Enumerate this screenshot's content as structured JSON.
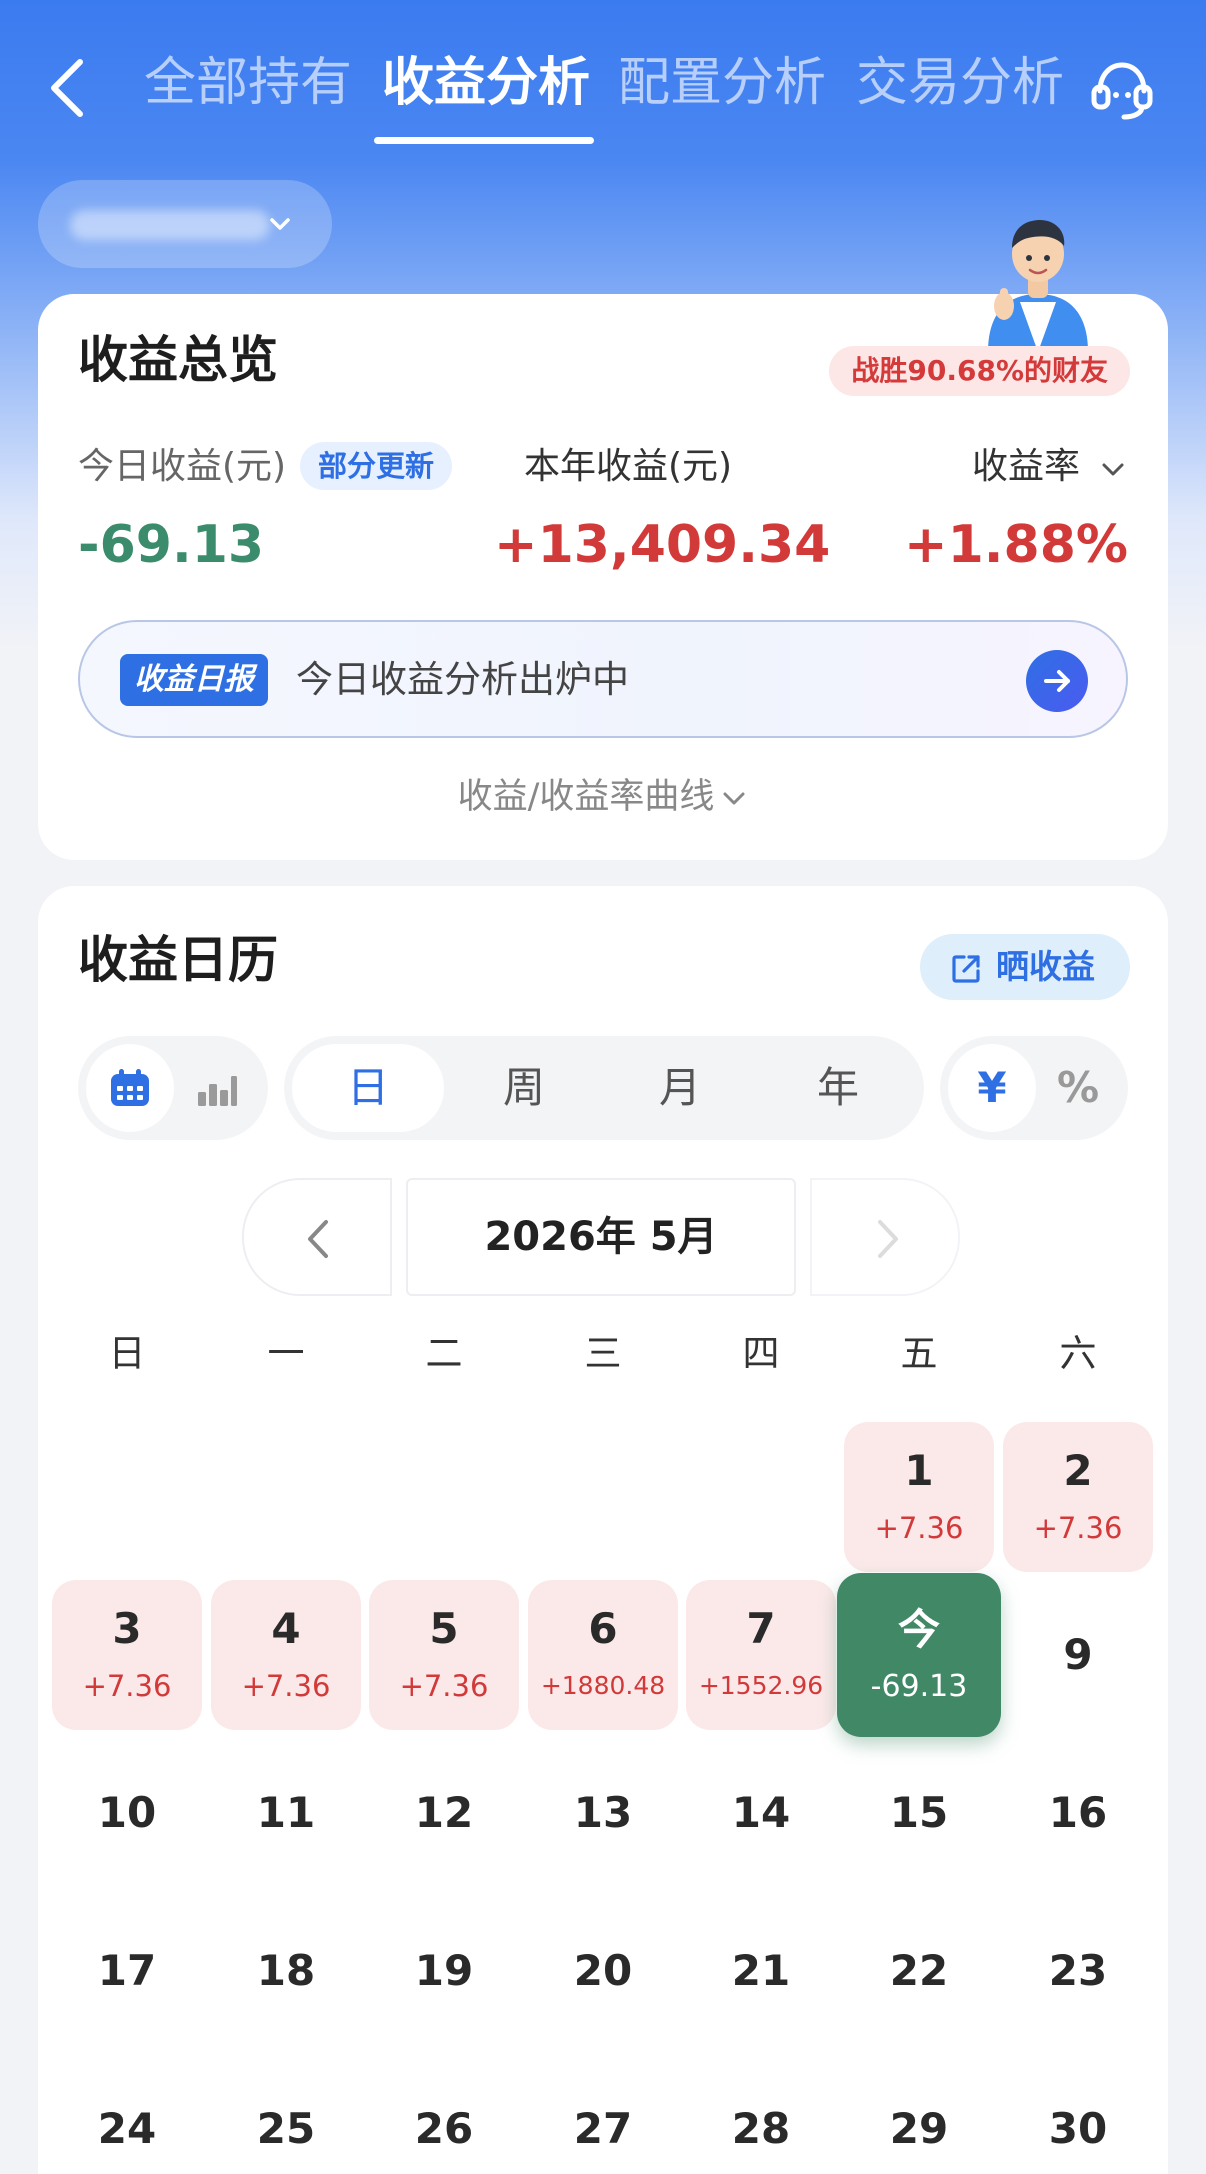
{
  "header": {
    "tabs": [
      {
        "label": "全部持有",
        "active": false
      },
      {
        "label": "收益分析",
        "active": true
      },
      {
        "label": "配置分析",
        "active": false
      },
      {
        "label": "交易分析",
        "active": false
      }
    ],
    "back_icon": "chevron-left-icon",
    "service_icon": "customer-service-icon"
  },
  "account_selector": {
    "icon": "chevron-down-icon"
  },
  "overview": {
    "title": "收益总览",
    "beat_badge": "战胜90.68%的财友",
    "today_label": "今日收益(元)",
    "update_badge": "部分更新",
    "year_label": "本年收益(元)",
    "rate_label": "收益率",
    "today_value": "-69.13",
    "year_value": "+13,409.34",
    "rate_value": "+1.88%",
    "daily_report_tag": "收益日报",
    "daily_report_text": "今日收益分析出炉中",
    "curve_toggle": "收益/收益率曲线"
  },
  "calendar": {
    "title": "收益日历",
    "share_label": "晒收益",
    "view_modes": [
      {
        "icon": "calendar-icon",
        "active": true
      },
      {
        "icon": "bar-chart-icon",
        "active": false
      }
    ],
    "periods": [
      {
        "label": "日",
        "active": true
      },
      {
        "label": "周",
        "active": false
      },
      {
        "label": "月",
        "active": false
      },
      {
        "label": "年",
        "active": false
      }
    ],
    "units": [
      {
        "label": "¥",
        "active": true
      },
      {
        "label": "%",
        "active": false
      }
    ],
    "month_label": "2026年 5月",
    "weekdays": [
      "日",
      "一",
      "二",
      "三",
      "四",
      "五",
      "六"
    ],
    "days": [
      {
        "num": "1",
        "value": "+7.36",
        "col": 5,
        "row": 0
      },
      {
        "num": "2",
        "value": "+7.36",
        "col": 6,
        "row": 0
      },
      {
        "num": "3",
        "value": "+7.36",
        "col": 0,
        "row": 1
      },
      {
        "num": "4",
        "value": "+7.36",
        "col": 1,
        "row": 1
      },
      {
        "num": "5",
        "value": "+7.36",
        "col": 2,
        "row": 1
      },
      {
        "num": "6",
        "value": "+1880.48",
        "col": 3,
        "row": 1
      },
      {
        "num": "7",
        "value": "+1552.96",
        "col": 4,
        "row": 1
      },
      {
        "num": "今",
        "value": "-69.13",
        "col": 5,
        "row": 1,
        "today": true
      },
      {
        "num": "9",
        "col": 6,
        "row": 1
      },
      {
        "num": "10",
        "col": 0,
        "row": 2
      },
      {
        "num": "11",
        "col": 1,
        "row": 2
      },
      {
        "num": "12",
        "col": 2,
        "row": 2
      },
      {
        "num": "13",
        "col": 3,
        "row": 2
      },
      {
        "num": "14",
        "col": 4,
        "row": 2
      },
      {
        "num": "15",
        "col": 5,
        "row": 2
      },
      {
        "num": "16",
        "col": 6,
        "row": 2
      },
      {
        "num": "17",
        "col": 0,
        "row": 3
      },
      {
        "num": "18",
        "col": 1,
        "row": 3
      },
      {
        "num": "19",
        "col": 2,
        "row": 3
      },
      {
        "num": "20",
        "col": 3,
        "row": 3
      },
      {
        "num": "21",
        "col": 4,
        "row": 3
      },
      {
        "num": "22",
        "col": 5,
        "row": 3
      },
      {
        "num": "23",
        "col": 6,
        "row": 3
      },
      {
        "num": "24",
        "col": 0,
        "row": 4
      },
      {
        "num": "25",
        "col": 1,
        "row": 4
      },
      {
        "num": "26",
        "col": 2,
        "row": 4
      },
      {
        "num": "27",
        "col": 3,
        "row": 4
      },
      {
        "num": "28",
        "col": 4,
        "row": 4
      },
      {
        "num": "29",
        "col": 5,
        "row": 4
      },
      {
        "num": "30",
        "col": 6,
        "row": 4
      }
    ]
  },
  "colors": {
    "brand_blue": "#2f6fe4",
    "gain_red": "#d23a3a",
    "loss_green": "#3a8c6c",
    "today_green": "#418867"
  }
}
